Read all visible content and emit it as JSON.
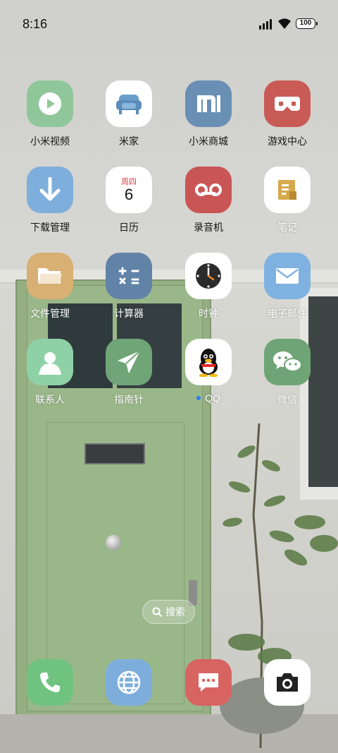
{
  "status_bar": {
    "time": "8:16",
    "battery": "100"
  },
  "apps": [
    {
      "label": "小米视频",
      "icon": "play-icon",
      "color": "#8fc79b"
    },
    {
      "label": "米家",
      "icon": "sofa-icon",
      "color": "#ffffff"
    },
    {
      "label": "小米商城",
      "icon": "mi-logo-icon",
      "color": "#6a8fb4"
    },
    {
      "label": "游戏中心",
      "icon": "gamepad-icon",
      "color": "#c85b56"
    },
    {
      "label": "下载管理",
      "icon": "download-arrow-icon",
      "color": "#7eaedb"
    },
    {
      "label": "日历",
      "icon": "calendar-icon",
      "color": "#ffffff",
      "weekday": "周四",
      "day": "6"
    },
    {
      "label": "录音机",
      "icon": "recorder-icon",
      "color": "#c95555"
    },
    {
      "label": "笔记",
      "icon": "notes-icon",
      "color": "#ffffff"
    },
    {
      "label": "文件管理",
      "icon": "folder-icon",
      "color": "#d8b073"
    },
    {
      "label": "计算器",
      "icon": "calculator-icon",
      "color": "#6283a8"
    },
    {
      "label": "时钟",
      "icon": "clock-icon",
      "color": "#ffffff"
    },
    {
      "label": "电子邮件",
      "icon": "envelope-icon",
      "color": "#7fb2e0"
    },
    {
      "label": "联系人",
      "icon": "person-icon",
      "color": "#8fd1a6"
    },
    {
      "label": "指南针",
      "icon": "paper-plane-icon",
      "color": "#6fa577"
    },
    {
      "label": "QQ",
      "icon": "qq-penguin-icon",
      "color": "#ffffff"
    },
    {
      "label": "微信",
      "icon": "wechat-icon",
      "color": "#6fa477"
    }
  ],
  "search": {
    "label": "搜索"
  },
  "dock": [
    {
      "name": "phone",
      "icon": "phone-icon",
      "color": "#6fc37f"
    },
    {
      "name": "browser",
      "icon": "globe-icon",
      "color": "#7daedb"
    },
    {
      "name": "messages",
      "icon": "message-icon",
      "color": "#d86462"
    },
    {
      "name": "camera",
      "icon": "camera-icon",
      "color": "#ffffff"
    }
  ]
}
